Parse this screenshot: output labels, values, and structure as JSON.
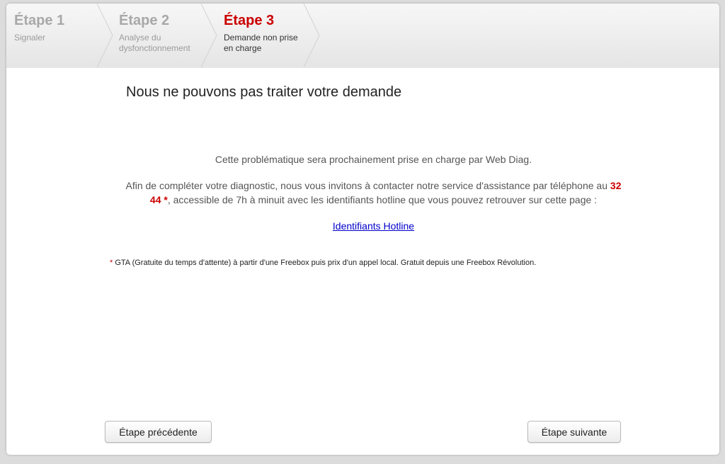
{
  "steps": [
    {
      "title": "Étape 1",
      "subtitle": "Signaler"
    },
    {
      "title": "Étape 2",
      "subtitle": "Analyse du\ndysfonctionnement"
    },
    {
      "title": "Étape 3",
      "subtitle": "Demande non prise\nen charge"
    }
  ],
  "main": {
    "title": "Nous ne pouvons pas traiter votre demande",
    "line1": "Cette problématique sera prochainement prise en charge par Web Diag.",
    "line2_part1": "Afin de compléter votre diagnostic, nous vous invitons à contacter notre service d'assistance par téléphone au ",
    "line2_number_a": "32",
    "line2_number_b": "44 *",
    "line2_part2": ", accessible de 7h à minuit avec les identifiants hotline que vous pouvez retrouver sur cette page :",
    "link_label": "Identifiants Hotline"
  },
  "footnote": {
    "star": "*",
    "text": " GTA (Gratuite du temps d'attente) à partir d'une Freebox puis prix d'un appel local. Gratuit depuis une Freebox Révolution."
  },
  "buttons": {
    "prev_label": "Étape précédente",
    "next_label": "Étape suivante"
  },
  "colors": {
    "accent": "#cc0000",
    "link": "#0000cc"
  }
}
